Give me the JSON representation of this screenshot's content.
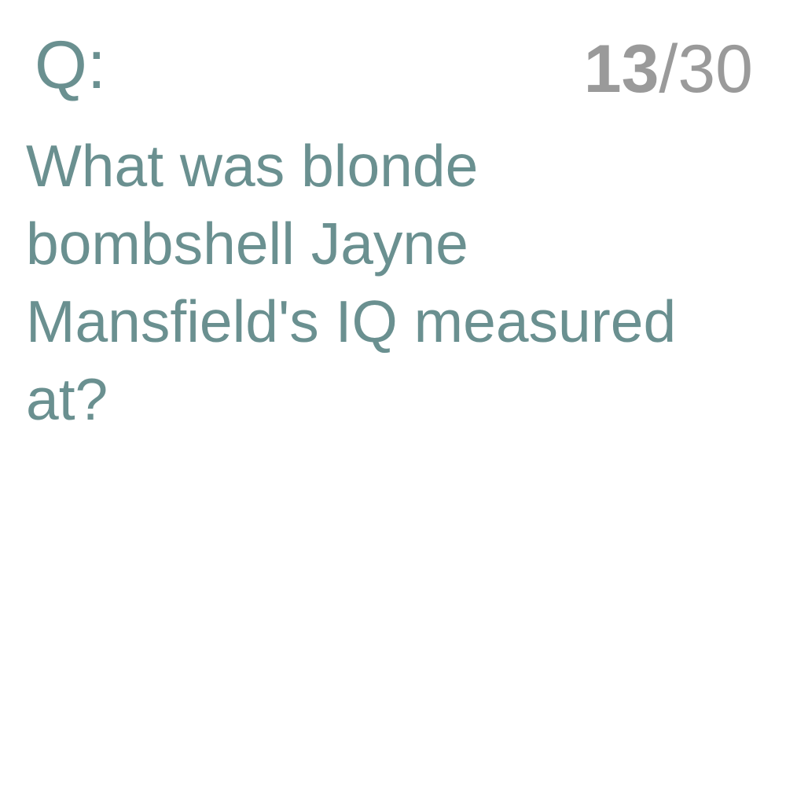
{
  "card": {
    "prefix": "Q:",
    "progress": {
      "current": "13",
      "separator": "/",
      "total": "30"
    },
    "question": "What was blonde bombshell Jayne Mansfield's IQ measured at?"
  },
  "colors": {
    "question_text": "#6a9090",
    "counter_text": "#9a9a9a",
    "background": "#ffffff"
  }
}
